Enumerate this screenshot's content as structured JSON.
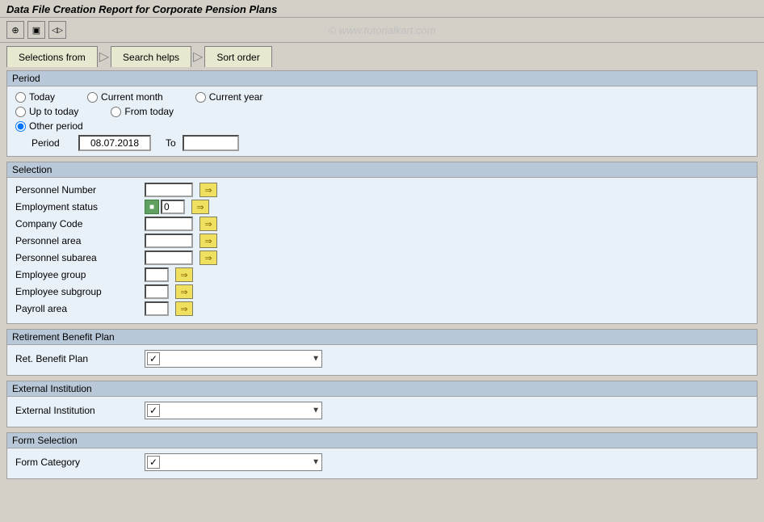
{
  "title": "Data File Creation Report for Corporate Pension Plans",
  "watermark": "© www.tutorialkart.com",
  "toolbar": {
    "buttons": [
      {
        "icon": "back-icon",
        "symbol": "⊕"
      },
      {
        "icon": "save-icon",
        "symbol": "▣"
      },
      {
        "icon": "forward-icon",
        "symbol": "◁▷"
      }
    ]
  },
  "tabs": [
    {
      "label": "Selections from",
      "id": "tab-selections"
    },
    {
      "label": "Search helps",
      "id": "tab-search"
    },
    {
      "label": "Sort order",
      "id": "tab-sort"
    }
  ],
  "period_section": {
    "header": "Period",
    "radios": [
      {
        "label": "Today",
        "name": "today",
        "checked": false
      },
      {
        "label": "Current month",
        "name": "current_month",
        "checked": false
      },
      {
        "label": "Current year",
        "name": "current_year",
        "checked": false
      },
      {
        "label": "Up to today",
        "name": "up_to_today",
        "checked": false
      },
      {
        "label": "From today",
        "name": "from_today",
        "checked": false
      },
      {
        "label": "Other period",
        "name": "other_period",
        "checked": true
      }
    ],
    "period_label": "Period",
    "period_from": "08.07.2018",
    "to_label": "To",
    "period_to": ""
  },
  "selection_section": {
    "header": "Selection",
    "fields": [
      {
        "label": "Personnel Number",
        "value": "",
        "has_icon": false
      },
      {
        "label": "Employment status",
        "value": "0",
        "has_icon": true
      },
      {
        "label": "Company Code",
        "value": "",
        "has_icon": false
      },
      {
        "label": "Personnel area",
        "value": "",
        "has_icon": false
      },
      {
        "label": "Personnel subarea",
        "value": "",
        "has_icon": false
      },
      {
        "label": "Employee group",
        "value": "",
        "has_icon": false
      },
      {
        "label": "Employee subgroup",
        "value": "",
        "has_icon": false
      },
      {
        "label": "Payroll area",
        "value": "",
        "has_icon": false
      }
    ]
  },
  "retirement_section": {
    "header": "Retirement Benefit Plan",
    "label": "Ret. Benefit Plan"
  },
  "external_section": {
    "header": "External Institution",
    "label": "External Institution"
  },
  "form_section": {
    "header": "Form Selection",
    "label": "Form Category"
  }
}
